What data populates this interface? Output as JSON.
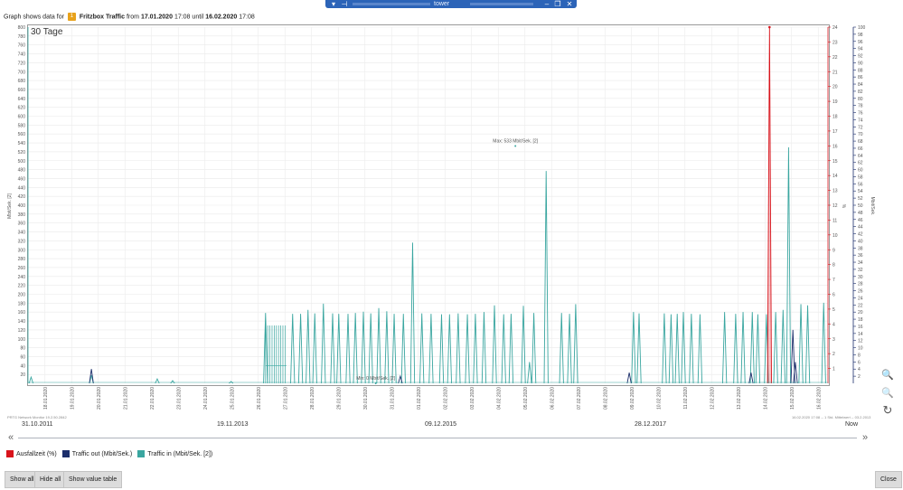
{
  "window": {
    "title": "tower"
  },
  "info": {
    "prefix": "Graph shows data for",
    "sensor_badge": "1",
    "sensor_name": "Fritzbox Traffic",
    "from_label": "from",
    "from_date": "17.01.2020",
    "from_time": "17:08",
    "until_label": "until",
    "until_date": "16.02.2020",
    "until_time": "17:08"
  },
  "chart_title": "30 Tage",
  "footnotes": {
    "left": "PRTG Network Monitor 19.2.50.2842",
    "right": "16.02.2020 17:08 -- 1 Std. Mittelwert -- 03.2.2013"
  },
  "timeline": {
    "labels": [
      "31.10.2011",
      "19.11.2013",
      "09.12.2015",
      "28.12.2017",
      "Now"
    ],
    "prev_icon": "double-chevron-left-icon",
    "next_icon": "double-chevron-right-icon"
  },
  "legend": [
    {
      "label": "Ausfallzeit  (%)",
      "color": "#d9141c"
    },
    {
      "label": "Traffic out  (Mbit/Sek.)",
      "color": "#1c2e6b"
    },
    {
      "label": "Traffic in  (Mbit/Sek. [2])",
      "color": "#3aa6a0"
    }
  ],
  "buttons": {
    "show_all": "Show all",
    "hide_all": "Hide all",
    "show_value_table": "Show value table",
    "close": "Close"
  },
  "zoom_icons": [
    "zoom-in-icon",
    "zoom-out-icon",
    "reset-zoom-icon"
  ],
  "chart_data": {
    "type": "line",
    "x_ticks": [
      "18.01.2020",
      "19.01.2020",
      "20.01.2020",
      "21.01.2020",
      "22.01.2020",
      "23.01.2020",
      "24.01.2020",
      "25.01.2020",
      "26.01.2020",
      "27.01.2020",
      "28.01.2020",
      "29.01.2020",
      "30.01.2020",
      "31.01.2020",
      "01.02.2020",
      "02.02.2020",
      "03.02.2020",
      "04.02.2020",
      "05.02.2020",
      "06.02.2020",
      "07.02.2020",
      "08.02.2020",
      "09.02.2020",
      "10.02.2020",
      "11.02.2020",
      "12.02.2020",
      "13.02.2020",
      "14.02.2020",
      "15.02.2020",
      "16.02.2020"
    ],
    "xlim": [
      17.0,
      30.0
    ],
    "y_left": {
      "label": "Mbit/Sek. [2]",
      "ylim": [
        0,
        800
      ],
      "ticks": [
        20,
        40,
        60,
        80,
        100,
        120,
        140,
        160,
        180,
        200,
        220,
        240,
        260,
        280,
        300,
        320,
        340,
        360,
        380,
        400,
        420,
        440,
        460,
        480,
        500,
        520,
        540,
        560,
        580,
        600,
        620,
        640,
        660,
        680,
        700,
        720,
        740,
        760,
        780,
        800
      ]
    },
    "y_right1": {
      "label": "%",
      "ylim": [
        0,
        24
      ],
      "ticks": [
        1,
        2,
        3,
        4,
        5,
        6,
        7,
        8,
        9,
        10,
        11,
        12,
        13,
        14,
        15,
        16,
        17,
        18,
        19,
        20,
        21,
        22,
        23,
        24
      ]
    },
    "y_right2": {
      "label": "Mbit/Sek.",
      "ylim": [
        0,
        100
      ],
      "ticks": [
        2,
        4,
        6,
        8,
        10,
        12,
        14,
        16,
        18,
        20,
        22,
        24,
        26,
        28,
        30,
        32,
        34,
        36,
        38,
        40,
        42,
        44,
        46,
        48,
        50,
        52,
        54,
        56,
        58,
        60,
        62,
        64,
        66,
        68,
        70,
        72,
        74,
        76,
        78,
        80,
        82,
        84,
        86,
        88,
        90,
        92,
        94,
        96,
        98,
        100
      ]
    },
    "annotations": [
      {
        "text": "Max: 533 Mbit/Sek. [2]",
        "x": 24.92,
        "y": 533
      },
      {
        "text": "Min: 0 Mbit/Sek. [2]",
        "x": 22.65,
        "y": 0
      }
    ],
    "series": [
      {
        "name": "Traffic in  (Mbit/Sek. [2])",
        "axis": "left",
        "color": "#3aa6a0",
        "spikes": [
          [
            17.05,
            14
          ],
          [
            18.03,
            18
          ],
          [
            19.1,
            10
          ],
          [
            19.35,
            6
          ],
          [
            20.3,
            4
          ],
          [
            20.86,
            158
          ],
          [
            21.3,
            156
          ],
          [
            21.43,
            156
          ],
          [
            21.55,
            165
          ],
          [
            21.66,
            157
          ],
          [
            21.8,
            179
          ],
          [
            21.95,
            157
          ],
          [
            22.05,
            156
          ],
          [
            22.2,
            156
          ],
          [
            22.32,
            158
          ],
          [
            22.45,
            161
          ],
          [
            22.57,
            157
          ],
          [
            22.7,
            169
          ],
          [
            22.83,
            162
          ],
          [
            22.95,
            156
          ],
          [
            23.1,
            156
          ],
          [
            23.25,
            316
          ],
          [
            23.4,
            157
          ],
          [
            23.55,
            156
          ],
          [
            23.72,
            155
          ],
          [
            23.85,
            155
          ],
          [
            23.99,
            157
          ],
          [
            24.14,
            155
          ],
          [
            24.27,
            156
          ],
          [
            24.41,
            160
          ],
          [
            24.58,
            175
          ],
          [
            24.73,
            155
          ],
          [
            24.85,
            156
          ],
          [
            25.05,
            174
          ],
          [
            25.15,
            48
          ],
          [
            25.22,
            158
          ],
          [
            25.42,
            477
          ],
          [
            25.67,
            158
          ],
          [
            25.8,
            156
          ],
          [
            25.9,
            178
          ],
          [
            26.84,
            160
          ],
          [
            26.93,
            157
          ],
          [
            27.34,
            157
          ],
          [
            27.45,
            155
          ],
          [
            27.55,
            156
          ],
          [
            27.65,
            160
          ],
          [
            27.78,
            156
          ],
          [
            27.92,
            155
          ],
          [
            28.32,
            160
          ],
          [
            28.5,
            156
          ],
          [
            28.62,
            160
          ],
          [
            28.77,
            160
          ],
          [
            28.86,
            155
          ],
          [
            29.0,
            155
          ],
          [
            29.15,
            160
          ],
          [
            29.27,
            165
          ],
          [
            29.36,
            530
          ],
          [
            29.56,
            178
          ],
          [
            29.67,
            175
          ],
          [
            29.93,
            181
          ]
        ]
      },
      {
        "name": "Traffic out  (Mbit/Sek.)",
        "axis": "right2",
        "color": "#1c2e6b",
        "spikes": [
          [
            18.03,
            4
          ],
          [
            23.05,
            2
          ],
          [
            26.77,
            3
          ],
          [
            28.75,
            3
          ],
          [
            29.43,
            15
          ],
          [
            29.47,
            6
          ]
        ]
      },
      {
        "name": "Ausfallzeit  (%)",
        "axis": "right1",
        "color": "#d9141c",
        "spikes": [
          [
            29.05,
            24
          ]
        ]
      }
    ]
  }
}
